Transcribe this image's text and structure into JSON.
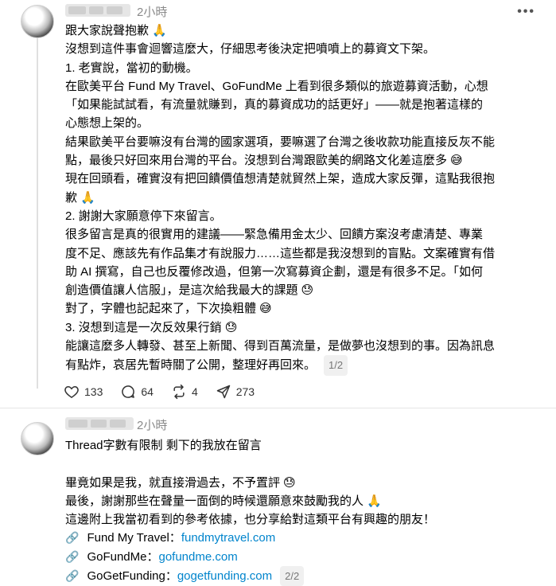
{
  "post1": {
    "time": "2小時",
    "lines": [
      "跟大家說聲抱歉",
      "沒想到這件事會迴響這麼大，仔細思考後決定把噴噴上的募資文下架。",
      "1. 老實說，當初的動機。",
      "在歐美平台 Fund My Travel、GoFundMe 上看到很多類似的旅遊募資活動，心想",
      "「如果能試試看，有流量就賺到，真的募資成功的話更好」——就是抱著這樣的",
      "心態想上架的。",
      "結果歐美平台要嘛沒有台灣的國家選項，要嘛選了台灣之後收款功能直接反灰不能",
      "點，最後只好回來用台灣的平台。沒想到台灣跟歐美的網路文化差這麼多",
      "現在回頭看，確實沒有把回饋價值想清楚就貿然上架，造成大家反彈，這點我很抱",
      "歉",
      "2. 謝謝大家願意停下來留言。",
      "很多留言是真的很實用的建議——緊急備用金太少、回饋方案沒考慮清楚、專業",
      "度不足、應該先有作品集才有說服力……這些都是我沒想到的盲點。文案確實有借",
      "助 AI 撰寫，自己也反覆修改過，但第一次寫募資企劃，還是有很多不足。「如何",
      "創造價值讓人信服」，是這次給我最大的課題",
      "對了，字體也記起來了，下次換粗體",
      "3. 沒想到這是一次反效果行銷",
      "能讓這麼多人轉發、甚至上新聞、得到百萬流量，是做夢也沒想到的事。因為訊息",
      "有點炸，哀居先暫時關了公開，整理好再回來。"
    ],
    "emojis": {
      "l0": "🙏",
      "l7": "😅",
      "l9": "🙏",
      "l14": "😓",
      "l15": "😅",
      "l16": "😓"
    },
    "page_indicator": "1/2",
    "actions": {
      "likes": "133",
      "comments": "64",
      "reposts": "4",
      "shares": "273"
    }
  },
  "post2": {
    "time": "2小時",
    "lines": [
      "Thread字數有限制 剩下的我放在留言",
      "",
      "畢竟如果是我，就直接滑過去，不予置評",
      "最後，謝謝那些在聲量一面倒的時候還願意來鼓勵我的人",
      "這邊附上我當初看到的參考依據，也分享給對這類平台有興趣的朋友！"
    ],
    "emojis": {
      "l2": "😓",
      "l3": "🙏"
    },
    "links": [
      {
        "label": "Fund My Travel：",
        "url": "fundmytravel.com"
      },
      {
        "label": "GoFundMe：",
        "url": "gofundme.com"
      },
      {
        "label": "GoGetFunding：",
        "url": "gogetfunding.com"
      }
    ],
    "page_indicator": "2/2"
  },
  "icons": {
    "more": "more-horizontal-icon",
    "like": "heart-icon",
    "comment": "comment-icon",
    "repost": "repost-icon",
    "share": "share-icon",
    "link": "link-icon"
  }
}
